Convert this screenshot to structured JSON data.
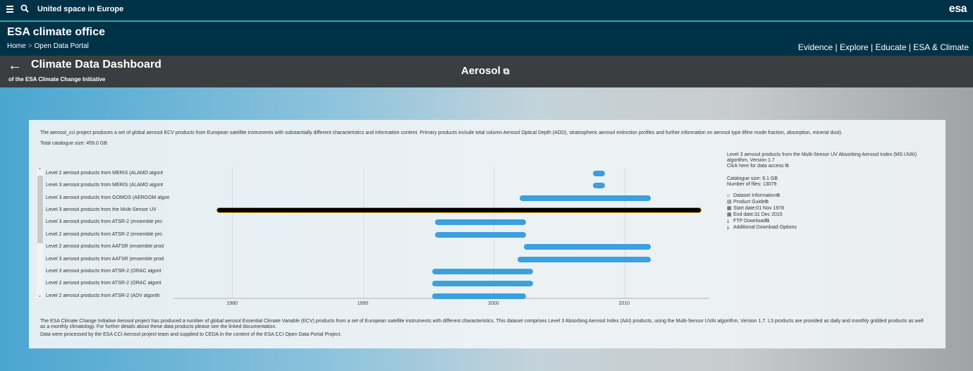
{
  "topbar": {
    "site_title": "United space in Europe",
    "logo": "esa"
  },
  "header": {
    "title": "ESA climate office",
    "breadcrumb": [
      "Home",
      "Open Data Portal"
    ],
    "breadcrumb_sep": ">",
    "nav": "Evidence | Explore | Educate | ESA & Climate"
  },
  "dashboard": {
    "back_glyph": "←",
    "title": "Climate Data Dashboard",
    "subtitle": "of the ESA Climate Change Initiative",
    "ecv": "Aerosol",
    "ext_glyph": "⧉"
  },
  "panel": {
    "intro": "The aerosol_cci project produces a set of global aerosol ECV products from European satellite instruments with substantially different characteristics and information content. Primary products include total column Aerosol Optical Depth (AOD), stratospheric aerosol extinction profiles and further information on aerosol type 8fine mode fraction, absorption, mineral dust).",
    "total": "Total catalogue size: 459.0 GB",
    "bottom1": "The ESA Climate Change Initiative Aerosol project has produced a number of global aerosol Essential Climate Variable (ECV) products from a set of European satellite instruments with different characteristics. This dataset comprises Level 3 Absorbing Aerosol Index (AAI) products, using the Multi-Sensor UVAI algorithm, Version 1.7. L3 products are provided as daily and monthly gridded products as well as a monthly climatology. For further details about these data products please see the linked documentation.",
    "bottom2": "Data were processed by the ESA CCI Aerosol project team and supplied to CEDA in the context of the ESA CCI Open Data Portal Project."
  },
  "chart_data": {
    "type": "timeline",
    "x_ticks": [
      "1980",
      "1990",
      "2000",
      "2010"
    ],
    "xlim": [
      1975.5,
      2016.5
    ],
    "rows": [
      {
        "label": "Level 2 aerosol products from MERIS (ALAMO algorit",
        "start": 2007.6,
        "end": 2008.5
      },
      {
        "label": "Level 3 aerosol products from MERIS (ALAMO algorit",
        "start": 2007.6,
        "end": 2008.5
      },
      {
        "label": "Level 3 aerosol products from GOMOS (AERGOM algori",
        "start": 2002.0,
        "end": 2012.0
      },
      {
        "label": "Level 3 aerosol products from the Multi-Sensor UV",
        "start": 1978.8,
        "end": 2015.9,
        "selected": true
      },
      {
        "label": "Level 3 aerosol products from ATSR-2 (ensemble pro",
        "start": 1995.5,
        "end": 2002.5
      },
      {
        "label": "Level 2 aerosol products from ATSR-2 (ensemble pro",
        "start": 1995.5,
        "end": 2002.5
      },
      {
        "label": "Level 2 aerosol products from AATSR (ensemble prod",
        "start": 2002.3,
        "end": 2012.0
      },
      {
        "label": "Level 3 aerosol products from AATSR (ensemble prod",
        "start": 2001.8,
        "end": 2012.0
      },
      {
        "label": "Level 3 aerosol products from ATSR-2 (ORAC algorit",
        "start": 1995.3,
        "end": 2003.0
      },
      {
        "label": "Level 2 aerosol products from ATSR-2 (ORAC algorit",
        "start": 1995.3,
        "end": 2003.0
      },
      {
        "label": "Level 2 aerosol products from ATSR-2 (ADV algorith",
        "start": 1995.3,
        "end": 2002.5
      }
    ],
    "bar_color": "#3aa0e0"
  },
  "info": {
    "name": "Level 3 aerosol products from the Multi-Sensor UV Absorbing Aerosol Index (MS UVAI) algorithm, Version 1.7",
    "access": "Click here for data access",
    "catalogue_size": "Catalogue size: 8.1 GB",
    "num_files": "Number of files: 13079",
    "links": [
      {
        "icon": "home-icon",
        "glyph": "⌂",
        "text": "Dataset Information",
        "ext": "⧉"
      },
      {
        "icon": "document-icon",
        "glyph": "▤",
        "text": "Product Guide",
        "ext": "⧉"
      },
      {
        "icon": "calendar-icon",
        "glyph": "▦",
        "text": "Start date:01 Nov 1978",
        "ext": ""
      },
      {
        "icon": "calendar-icon",
        "glyph": "▦",
        "text": "End date:31 Dec 2015",
        "ext": ""
      },
      {
        "icon": "download-icon",
        "glyph": "⤓",
        "text": "FTP Download",
        "ext": "⧉"
      },
      {
        "icon": "download-icon",
        "glyph": "⤓",
        "text": "Additional Download Options",
        "ext": ""
      }
    ]
  }
}
